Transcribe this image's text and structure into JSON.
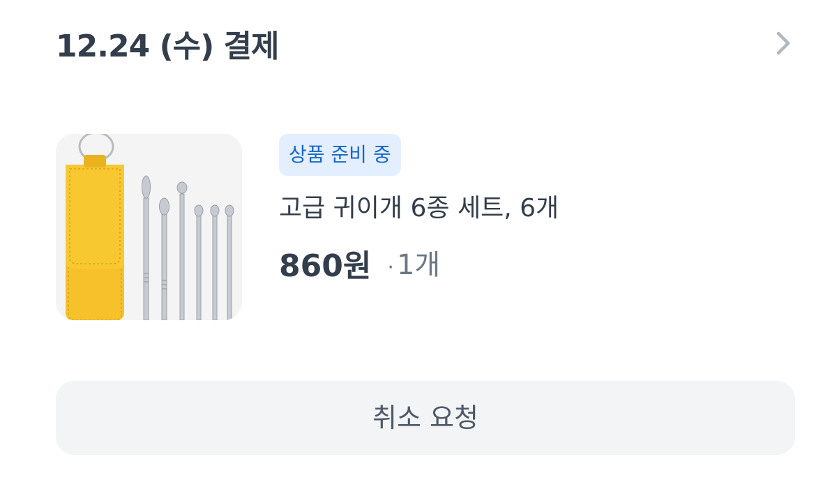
{
  "order": {
    "date_label": "12.24 (수) 결제"
  },
  "product": {
    "status": "상품 준비 중",
    "name": "고급 귀이개 6종 세트, 6개",
    "price": "860원",
    "quantity": "1개",
    "image_icon": "ear-pick-set-image"
  },
  "actions": {
    "cancel_label": "취소 요청"
  },
  "colors": {
    "text_primary": "#333d4b",
    "text_secondary": "#6b7684",
    "badge_bg": "#e3efff",
    "badge_text": "#1766c5",
    "button_bg": "#f2f4f6",
    "chevron": "#b0b8c1",
    "pouch_yellow": "#f6c12b"
  }
}
